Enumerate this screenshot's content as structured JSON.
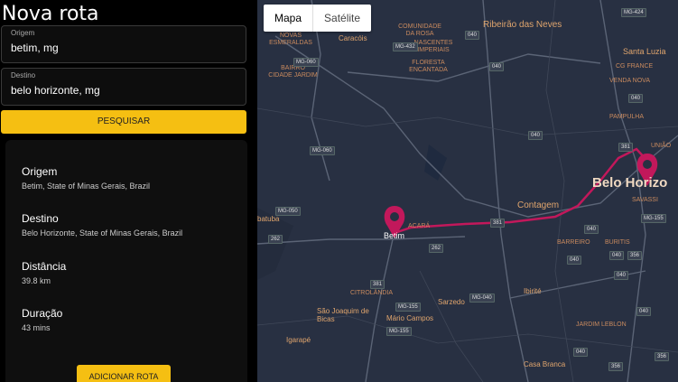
{
  "header": {
    "title": "Nova rota"
  },
  "origin": {
    "label": "Origem",
    "value": "betim, mg"
  },
  "destination": {
    "label": "Destino",
    "value": "belo horizonte, mg"
  },
  "search_button": "PESQUISAR",
  "route_info": {
    "origin_title": "Origem",
    "origin_value": "Betim, State of Minas Gerais, Brazil",
    "destination_title": "Destino",
    "destination_value": "Belo Horizonte, State of Minas Gerais, Brazil",
    "distance_title": "Distância",
    "distance_value": "39.8 km",
    "duration_title": "Duração",
    "duration_value": "43 mins"
  },
  "add_route_button": "ADICIONAR ROTA",
  "map": {
    "type_toggle": {
      "map": "Mapa",
      "satellite": "Satélite"
    },
    "labels": {
      "ribeirao": "Ribeirão das Neves",
      "comunidade": "COMUNIDADE DA ROSA",
      "novas": "NOVAS ESMERALDAS",
      "caracois": "Caracóis",
      "nascentes": "NASCENTES IMPERIAIS",
      "floresta": "FLORESTA ENCANTADA",
      "bairro": "BAIRRO CIDADE JARDIM",
      "santaluzia": "Santa Luzia",
      "cgrande": "CG FRANCE",
      "vendanova": "VENDA NOVA",
      "pampulha": "PAMPULHA",
      "uniao": "UNIÃO",
      "contagem": "Contagem",
      "acara": "ACARÁ",
      "betim": "Betim",
      "belohorizonte": "Belo Horizo",
      "savassi": "SAVASSI",
      "barreiro": "BARREIRO",
      "buritis": "BURITIS",
      "ibirite": "Ibirité",
      "sarzedo": "Sarzedo",
      "citrolandia": "CITROLÂNDIA",
      "saojoaquim": "São Joaquim de Bicas",
      "mariocampos": "Mário Campos",
      "igarape": "Igarapé",
      "jardimleblon": "JARDIM LEBLON",
      "casabranca": "Casa Branca",
      "bateia": "batuba"
    },
    "roads": [
      "MG-424",
      "040",
      "MG-432",
      "040",
      "MG-060",
      "040",
      "040",
      "MG-060",
      "MG-050",
      "381",
      "262",
      "262",
      "040",
      "381",
      "MG-155",
      "MG-155",
      "MG-040",
      "040",
      "356",
      "040",
      "MG-155",
      "040",
      "040",
      "040",
      "356",
      "356",
      "381"
    ],
    "colors": {
      "route": "#c2185b",
      "marker": "#c2185b"
    }
  }
}
